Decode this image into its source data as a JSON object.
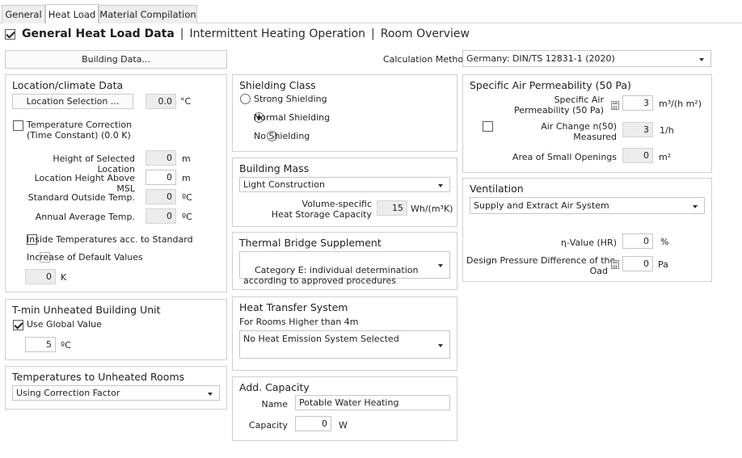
{
  "tabs": [
    "General",
    "Heat Load",
    "Material Compilation"
  ],
  "header": {
    "checked": true,
    "title": "General Heat Load Data",
    "sep1": "|",
    "link1": "Intermittent Heating Operation",
    "sep2": "|",
    "link2": "Room Overview"
  },
  "building_data_button": "Building Data...",
  "calc_method": {
    "label": "Calculation Method",
    "value": "Germany: DIN/TS 12831-1 (2020)"
  },
  "location": {
    "title": "Location/climate Data",
    "selection_button": "Location Selection ...",
    "selection_value": "0.0",
    "selection_unit": "°C",
    "temp_correction": "Temperature Correction\n(Time Constant) (0.0 K)",
    "rows": [
      {
        "label": "Height of Selected Location",
        "value": "0",
        "unit": "m",
        "readonly": true
      },
      {
        "label": "Location Height Above MSL",
        "value": "0",
        "unit": "m",
        "readonly": false
      },
      {
        "label": "Standard Outside Temp.",
        "value": "0",
        "unit": "ºC",
        "readonly": true
      },
      {
        "label": "Annual Average Temp.",
        "value": "0",
        "unit": "ºC",
        "readonly": true
      }
    ],
    "inside_temps": "Inside Temperatures acc. to Standard",
    "increase_default": "Increase of Default Values",
    "increase_value": "0",
    "increase_unit": "K"
  },
  "tmin": {
    "title": "T-min Unheated Building Unit",
    "use_global": "Use Global Value",
    "value": "5",
    "unit": "ºC"
  },
  "unheated": {
    "title": "Temperatures to Unheated Rooms",
    "value": "Using Correction Factor"
  },
  "shielding": {
    "title": "Shielding Class",
    "options": [
      "Strong Shielding",
      "Normal Shielding",
      "No Shielding"
    ],
    "selected": 1
  },
  "mass": {
    "title": "Building Mass",
    "value": "Light Construction",
    "cap_label": "Volume-specific\nHeat Storage Capacity",
    "cap_value": "15",
    "cap_unit": "Wh/(m³K)"
  },
  "thermal_bridge": {
    "title": "Thermal Bridge Supplement",
    "value": "Category E: individual determination\naccording to approved procedures"
  },
  "heat_transfer": {
    "title": "Heat Transfer System",
    "sub": "For Rooms Higher than 4m",
    "value": "No Heat Emission System Selected"
  },
  "capacity": {
    "title": "Add. Capacity",
    "name_label": "Name",
    "name_value": "Potable Water Heating",
    "cap_label": "Capacity",
    "cap_value": "0",
    "cap_unit": "W"
  },
  "air_perm": {
    "title": "Specific Air Permeability (50 Pa)",
    "perm_label": "Specific Air\nPermeability (50 Pa)",
    "perm_value": "3",
    "perm_unit": "m³/(h m²)",
    "ach_label": "Air Change n(50)\nMeasured",
    "ach_value": "3",
    "ach_unit": "1/h",
    "openings_label": "Area of Small Openings",
    "openings_value": "0",
    "openings_unit": "m²"
  },
  "ventilation": {
    "title": "Ventilation",
    "value": "Supply and Extract Air System",
    "eta_label": "η-Value (HR)",
    "eta_value": "0",
    "eta_unit": "%",
    "dp_label": "Design Pressure Difference of the\nOad",
    "dp_value": "0",
    "dp_unit": "Pa"
  }
}
